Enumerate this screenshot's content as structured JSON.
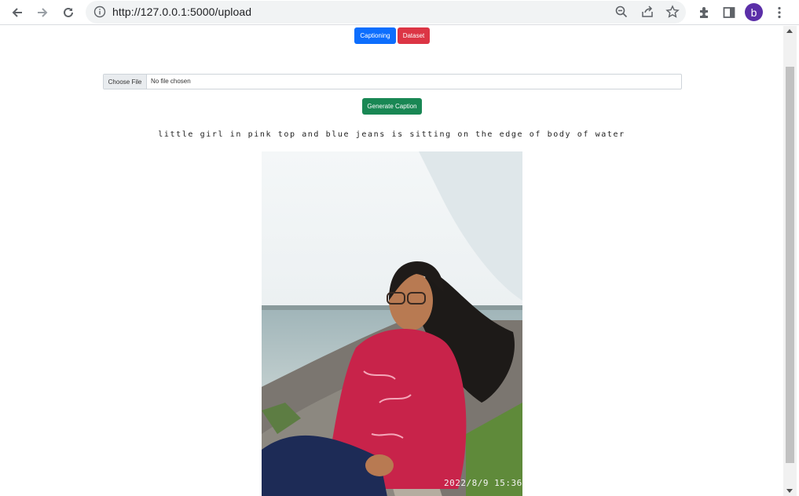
{
  "browser": {
    "url": "http://127.0.0.1:5000/upload",
    "profile_initial": "b",
    "icons": [
      "back-icon",
      "forward-icon",
      "reload-icon",
      "info-icon",
      "zoom-out-icon",
      "share-icon",
      "star-icon",
      "extensions-icon",
      "side-panel-icon",
      "menu-icon"
    ]
  },
  "nav": {
    "captioning_label": "Captioning",
    "dataset_label": "Dataset"
  },
  "upload": {
    "choose_label": "Choose File",
    "status_text": "No file chosen"
  },
  "generate_label": "Generate Caption",
  "caption_text": "little girl in pink top and blue jeans is sitting on the edge of body of water",
  "photo": {
    "timestamp": "2022/8/9 15:36"
  },
  "colors": {
    "primary": "#0d6efd",
    "danger": "#dc3545",
    "success": "#198754"
  }
}
